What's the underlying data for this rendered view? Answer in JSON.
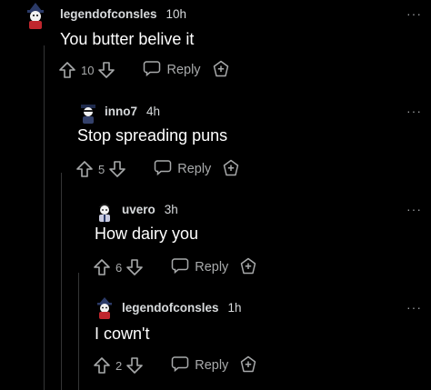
{
  "comments": [
    {
      "username": "legendofconsles",
      "age": "10h",
      "text": "You butter belive it",
      "votes": "10",
      "reply_label": "Reply",
      "more_label": "···"
    },
    {
      "username": "inno7",
      "age": "4h",
      "text": "Stop spreading puns",
      "votes": "5",
      "reply_label": "Reply",
      "more_label": "···"
    },
    {
      "username": "uvero",
      "age": "3h",
      "text": "How dairy you",
      "votes": "6",
      "reply_label": "Reply",
      "more_label": "···"
    },
    {
      "username": "legendofconsles",
      "age": "1h",
      "text": "I cown't",
      "votes": "2",
      "reply_label": "Reply",
      "more_label": "···"
    }
  ],
  "colors": {
    "background": "#000000",
    "text": "#d7dadc",
    "muted": "#9a9c9e",
    "thread_line": "#343536"
  },
  "icons": [
    "upvote-arrow-icon",
    "downvote-arrow-icon",
    "reply-bubble-icon",
    "award-icon",
    "more-options-icon",
    "user-avatar"
  ]
}
